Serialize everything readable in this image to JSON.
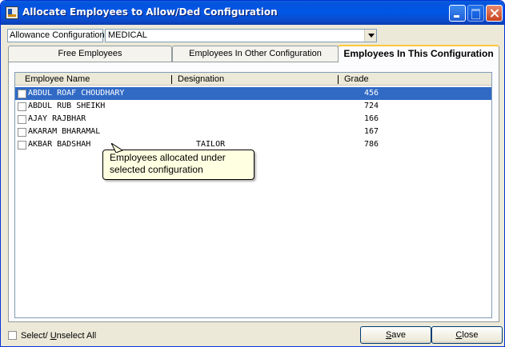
{
  "window": {
    "title": "Allocate Employees to Allow/Ded Configuration"
  },
  "allowance": {
    "label": "Allowance Configuration",
    "selected": "MEDICAL"
  },
  "tabs": [
    {
      "label": "Free Employees",
      "active": false
    },
    {
      "label": "Employees In Other Configuration",
      "active": false
    },
    {
      "label": "Employees In This Configuration",
      "active": true
    }
  ],
  "table": {
    "columns": [
      "Employee Name",
      "Designation",
      "Grade"
    ],
    "rows": [
      {
        "name": "ABDUL ROAF CHOUDHARY",
        "designation": "",
        "grade": "456",
        "checked": false,
        "selected": true
      },
      {
        "name": "ABDUL RUB SHEIKH",
        "designation": "",
        "grade": "724",
        "checked": false,
        "selected": false
      },
      {
        "name": "AJAY RAJBHAR",
        "designation": "",
        "grade": "166",
        "checked": false,
        "selected": false
      },
      {
        "name": "AKARAM BHARAMAL",
        "designation": "",
        "grade": "167",
        "checked": false,
        "selected": false
      },
      {
        "name": "AKBAR BADSHAH",
        "designation": "TAILOR",
        "grade": "786",
        "checked": false,
        "selected": false
      }
    ]
  },
  "tooltip": {
    "text": "Employees allocated under selected configuration"
  },
  "footer": {
    "select_all_prefix": "Select/ ",
    "select_all_accel": "U",
    "select_all_suffix": "nselect All",
    "save_accel": "S",
    "save_rest": "ave",
    "close_accel": "C",
    "close_rest": "lose"
  },
  "colors": {
    "title_bar": "#0054e3",
    "selection": "#316ac5",
    "tooltip_bg": "#ffffe1",
    "window_bg": "#ece9d8"
  }
}
